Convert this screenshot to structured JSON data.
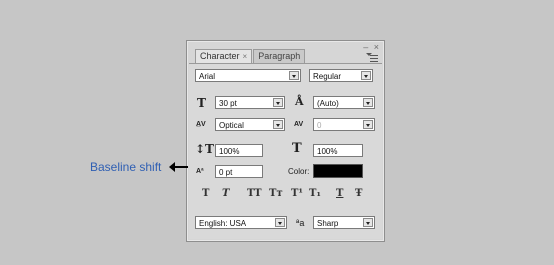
{
  "panel": {
    "window_controls": {
      "minimize": "–",
      "close": "×"
    },
    "tabs": [
      {
        "label": "Character",
        "close": "×",
        "active": true
      },
      {
        "label": "Paragraph",
        "active": false
      }
    ]
  },
  "font": {
    "family": "Arial",
    "style": "Regular"
  },
  "size": {
    "value": "30 pt"
  },
  "leading": {
    "value": "(Auto)"
  },
  "kerning": {
    "value": "Optical"
  },
  "tracking": {
    "value": "0"
  },
  "vertical_scale": {
    "value": "100%"
  },
  "horizontal_scale": {
    "value": "100%"
  },
  "baseline_shift": {
    "value": "0 pt"
  },
  "color": {
    "label": "Color:",
    "swatch": "#000000"
  },
  "style_buttons": [
    "T",
    "T",
    "TT",
    "Tт",
    "T¹",
    "T₁",
    "T",
    "Ŧ"
  ],
  "language": {
    "value": "English: USA"
  },
  "antialias": {
    "icon": "ªa",
    "value": "Sharp"
  },
  "annotation": {
    "text": "Baseline shift"
  },
  "icons": {
    "size": "size-icon",
    "leading": "leading-icon",
    "kerning": "kerning-icon",
    "tracking": "tracking-icon",
    "vscale": "vertical-scale-icon",
    "hscale": "horizontal-scale-icon",
    "baseline": "baseline-shift-icon",
    "arrow": "arrow-left-icon"
  }
}
